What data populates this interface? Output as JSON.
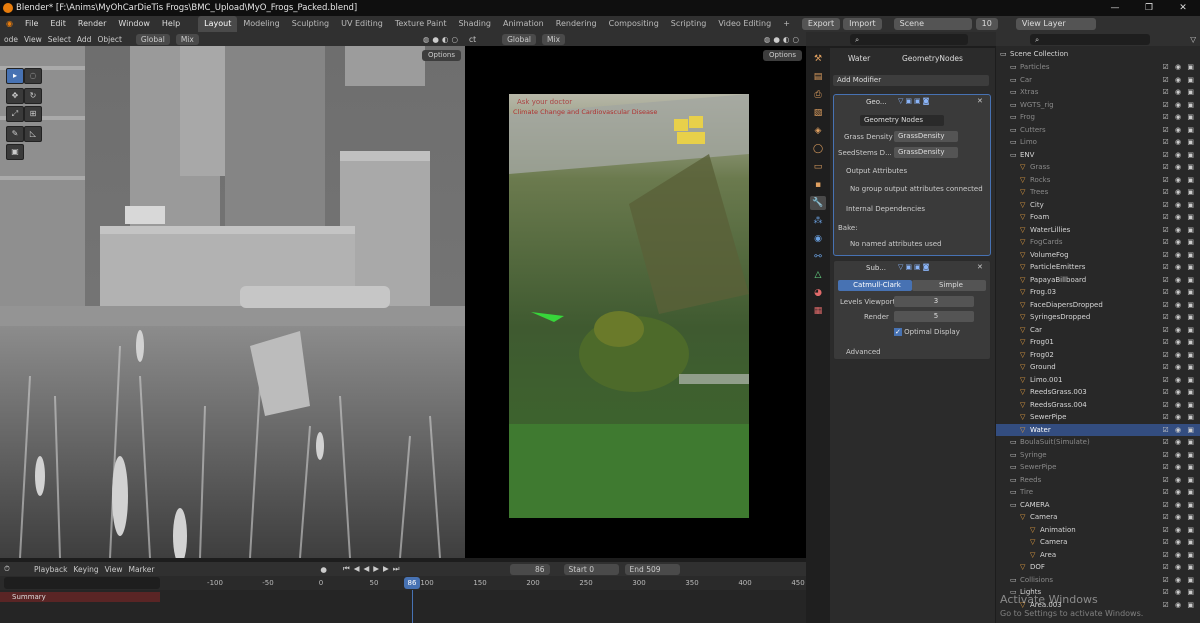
{
  "window": {
    "title": "Blender* [F:\\Anims\\MyOhCarDieTis Frogs\\BMC_Upload\\MyO_Frogs_Packed.blend]",
    "controls": [
      "—",
      "❐",
      "✕"
    ]
  },
  "menu": [
    "File",
    "Edit",
    "Render",
    "Window",
    "Help"
  ],
  "workspaces": [
    "Layout",
    "Modeling",
    "Sculpting",
    "UV Editing",
    "Texture Paint",
    "Shading",
    "Animation",
    "Rendering",
    "Compositing",
    "Scripting",
    "Video Editing"
  ],
  "active_workspace": "Layout",
  "topbar": {
    "export": "Export",
    "import": "Import",
    "scene": "Scene",
    "scene_num": "10",
    "view_layer": "View Layer"
  },
  "viewport_left": {
    "mode": "ode",
    "menus": [
      "View",
      "Select",
      "Add",
      "Object"
    ],
    "orientation": "Global",
    "pivot": "Mix",
    "options": "Options"
  },
  "viewport_right": {
    "prefix": "ct",
    "orientation": "Global",
    "pivot": "Mix",
    "options": "Options",
    "billboard_text": "Climate Change and Cardiovascular Disease",
    "billboard_top": "Ask your doctor"
  },
  "properties": {
    "object": "Water",
    "modifier_stack": "GeometryNodes",
    "add_modifier": "Add Modifier",
    "geo": {
      "short": "Geo...",
      "node_group": "Geometry Nodes",
      "inputs": [
        {
          "label": "Grass Density",
          "value": "GrassDensity"
        },
        {
          "label": "SeedStems D...",
          "value": "GrassDensity"
        }
      ],
      "output_attributes": "Output Attributes",
      "no_output": "No group output attributes connected",
      "internal_deps": "Internal Dependencies",
      "bake": "Bake:",
      "no_named": "No named attributes used"
    },
    "subsurf": {
      "short": "Sub...",
      "catmull": "Catmull-Clark",
      "simple": "Simple",
      "levels_viewport_label": "Levels Viewport",
      "levels_viewport": "3",
      "render_label": "Render",
      "render": "5",
      "optimal": "Optimal Display",
      "advanced": "Advanced"
    }
  },
  "outliner": {
    "root": "Scene Collection",
    "items": [
      {
        "name": "Particles",
        "indent": 1,
        "dim": true
      },
      {
        "name": "Car",
        "indent": 1,
        "dim": true
      },
      {
        "name": "Xtras",
        "indent": 1,
        "dim": true
      },
      {
        "name": "WGTS_rig",
        "indent": 1,
        "dim": true
      },
      {
        "name": "Frog",
        "indent": 1,
        "dim": true
      },
      {
        "name": "Cutters",
        "indent": 1,
        "dim": true
      },
      {
        "name": "Limo",
        "indent": 1,
        "dim": true
      },
      {
        "name": "ENV",
        "indent": 1
      },
      {
        "name": "Grass",
        "indent": 2,
        "dim": true
      },
      {
        "name": "Rocks",
        "indent": 2,
        "dim": true
      },
      {
        "name": "Trees",
        "indent": 2,
        "dim": true
      },
      {
        "name": "City",
        "indent": 2
      },
      {
        "name": "Foam",
        "indent": 2
      },
      {
        "name": "WaterLillies",
        "indent": 2
      },
      {
        "name": "FogCards",
        "indent": 2,
        "dim": true
      },
      {
        "name": "VolumeFog",
        "indent": 2
      },
      {
        "name": "ParticleEmitters",
        "indent": 2
      },
      {
        "name": "PapayaBillboard",
        "indent": 2
      },
      {
        "name": "Frog.03",
        "indent": 2
      },
      {
        "name": "FaceDiapersDropped",
        "indent": 2
      },
      {
        "name": "SyringesDropped",
        "indent": 2
      },
      {
        "name": "Car",
        "indent": 2
      },
      {
        "name": "Frog01",
        "indent": 2
      },
      {
        "name": "Frog02",
        "indent": 2
      },
      {
        "name": "Ground",
        "indent": 2
      },
      {
        "name": "Limo.001",
        "indent": 2
      },
      {
        "name": "ReedsGrass.003",
        "indent": 2
      },
      {
        "name": "ReedsGrass.004",
        "indent": 2
      },
      {
        "name": "SewerPipe",
        "indent": 2
      },
      {
        "name": "Water",
        "indent": 2,
        "selected": true
      },
      {
        "name": "BoulaSuit(Simulate)",
        "indent": 1,
        "dim": true
      },
      {
        "name": "Syringe",
        "indent": 1,
        "dim": true
      },
      {
        "name": "SewerPipe",
        "indent": 1,
        "dim": true
      },
      {
        "name": "Reeds",
        "indent": 1,
        "dim": true
      },
      {
        "name": "Tire",
        "indent": 1,
        "dim": true
      },
      {
        "name": "CAMERA",
        "indent": 1
      },
      {
        "name": "Camera",
        "indent": 2
      },
      {
        "name": "Animation",
        "indent": 3
      },
      {
        "name": "Camera",
        "indent": 3
      },
      {
        "name": "Area",
        "indent": 3
      },
      {
        "name": "DOF",
        "indent": 2
      },
      {
        "name": "Collisions",
        "indent": 1,
        "dim": true
      },
      {
        "name": "Lights",
        "indent": 1
      },
      {
        "name": "Area.003",
        "indent": 2
      }
    ]
  },
  "timeline": {
    "menus": [
      "Playback",
      "Keying",
      "View",
      "Marker"
    ],
    "current_frame": "86",
    "start_label": "Start",
    "start": "0",
    "end_label": "End",
    "end": "509",
    "summary": "Summary",
    "ticks": [
      "-100",
      "-50",
      "0",
      "50",
      "100",
      "150",
      "200",
      "250",
      "300",
      "350",
      "400",
      "450"
    ]
  },
  "watermark": {
    "line1": "Activate Windows",
    "line2": "Go to Settings to activate Windows."
  },
  "colors": {
    "accent": "#4772b3",
    "selection": "#334d80",
    "orange": "#e87d0d",
    "frame": "#4772b3"
  }
}
